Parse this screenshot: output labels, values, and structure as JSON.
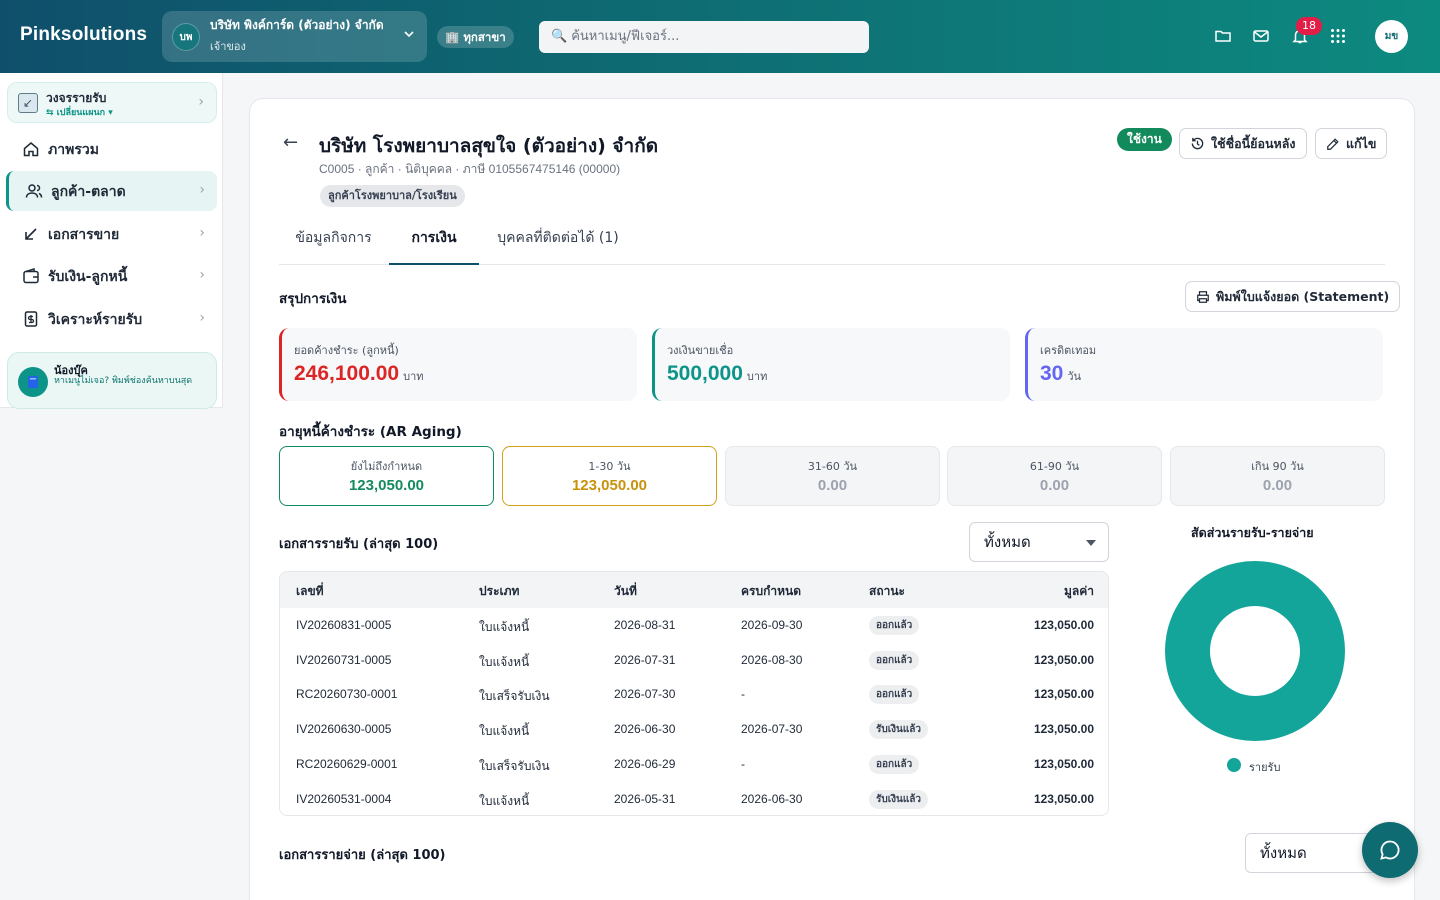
{
  "topbar": {
    "brand": "Pinksolutions",
    "company_initials": "บพ",
    "company_name": "บริษัท พิงค์การ์ด (ตัวอย่าง) จำกัด",
    "company_role": "เจ้าของ",
    "branch": "ทุกสาขา",
    "branch_icon": "🏢",
    "search_placeholder": "ค้นหาเมนู/ฟีเจอร์...",
    "notification_count": "18",
    "user_initials": "มข"
  },
  "sidebar": {
    "plan_title": "วงจรรายรับ",
    "plan_switch": "⇆ เปลี่ยนแผนก ▾",
    "items": [
      {
        "label": "ภาพรวม",
        "icon": "home-icon"
      },
      {
        "label": "ลูกค้า-ตลาด",
        "icon": "users-icon",
        "active": true
      },
      {
        "label": "เอกสารขาย",
        "icon": "arrow-down-left-icon"
      },
      {
        "label": "รับเงิน-ลูกหนี้",
        "icon": "wallet-icon"
      },
      {
        "label": "วิเคราะห์รายรับ",
        "icon": "receipt-icon"
      }
    ],
    "helper_title": "น้องบุ๊ค",
    "helper_text": "หาเมนูไม่เจอ? พิมพ์ช่องค้นหาบนสุด"
  },
  "customer": {
    "name": "บริษัท โรงพยาบาลสุขใจ (ตัวอย่าง) จำกัด",
    "meta": "C0005 · ลูกค้า · นิติบุคคล · ภาษี 0105567475146 (00000)",
    "tag": "ลูกค้าโรงพยาบาล/โรงเรียน",
    "status": "ใช้งาน",
    "history_button": "ใช้ชื่อนี้ย้อนหลัง",
    "edit_button": "แก้ไข"
  },
  "tabs": [
    "ข้อมูลกิจการ",
    "การเงิน",
    "บุคคลที่ติดต่อได้ (1)"
  ],
  "finance": {
    "section_title": "สรุปการเงิน",
    "print_button": "พิมพ์ใบแจ้งยอด (Statement)",
    "cards": [
      {
        "label": "ยอดค้างชำระ (ลูกหนี้)",
        "value": "246,100.00",
        "unit": "บาท",
        "color": "#dc2626"
      },
      {
        "label": "วงเงินขายเชื่อ",
        "value": "500,000",
        "unit": "บาท",
        "color": "#0d9488"
      },
      {
        "label": "เครดิตเทอม",
        "value": "30",
        "unit": "วัน",
        "color": "#6366f1"
      }
    ]
  },
  "aging": {
    "title": "อายุหนี้ค้างชำระ (AR Aging)",
    "buckets": [
      {
        "label": "ยังไม่ถึงกำหนด",
        "value": "123,050.00"
      },
      {
        "label": "1-30 วัน",
        "value": "123,050.00"
      },
      {
        "label": "31-60 วัน",
        "value": "0.00"
      },
      {
        "label": "61-90 วัน",
        "value": "0.00"
      },
      {
        "label": "เกิน 90 วัน",
        "value": "0.00"
      }
    ]
  },
  "income_docs": {
    "title": "เอกสารรายรับ (ล่าสุด 100)",
    "filter": "ทั้งหมด",
    "columns": [
      "เลขที่",
      "ประเภท",
      "วันที่",
      "ครบกำหนด",
      "สถานะ",
      "มูลค่า"
    ],
    "rows": [
      [
        "IV20260831-0005",
        "ใบแจ้งหนี้",
        "2026-08-31",
        "2026-09-30",
        "ออกแล้ว",
        "123,050.00"
      ],
      [
        "IV20260731-0005",
        "ใบแจ้งหนี้",
        "2026-07-31",
        "2026-08-30",
        "ออกแล้ว",
        "123,050.00"
      ],
      [
        "RC20260730-0001",
        "ใบเสร็จรับเงิน",
        "2026-07-30",
        "-",
        "ออกแล้ว",
        "123,050.00"
      ],
      [
        "IV20260630-0005",
        "ใบแจ้งหนี้",
        "2026-06-30",
        "2026-07-30",
        "รับเงินแล้ว",
        "123,050.00"
      ],
      [
        "RC20260629-0001",
        "ใบเสร็จรับเงิน",
        "2026-06-29",
        "-",
        "ออกแล้ว",
        "123,050.00"
      ],
      [
        "IV20260531-0004",
        "ใบแจ้งหนี้",
        "2026-05-31",
        "2026-06-30",
        "รับเงินแล้ว",
        "123,050.00"
      ]
    ]
  },
  "ratio_chart": {
    "title": "สัดส่วนรายรับ-รายจ่าย",
    "legend": "รายรับ",
    "color": "#14a59a"
  },
  "chart_data": {
    "type": "pie",
    "title": "สัดส่วนรายรับ-รายจ่าย",
    "categories": [
      "รายรับ"
    ],
    "values": [
      100
    ],
    "legend_position": "bottom"
  },
  "expense_docs": {
    "title": "เอกสารรายจ่าย (ล่าสุด 100)",
    "filter": "ทั้งหมด"
  }
}
